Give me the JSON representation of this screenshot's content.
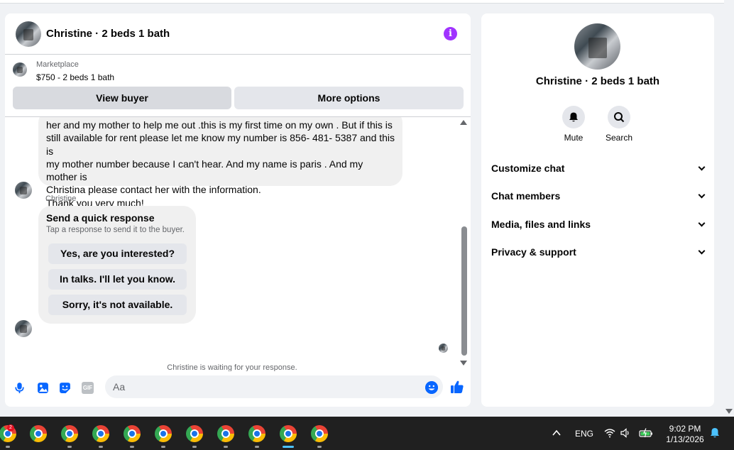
{
  "chat": {
    "title": "Christine · 2 beds 1 bath",
    "listing": {
      "label": "Marketplace",
      "price_title": "$750 - 2 beds 1 bath",
      "view_buyer": "View buyer",
      "more_options": "More options"
    },
    "message_lines": [
      "her and my mother to help me out .this is my first time on my own . But if this is",
      "still available for rent please let me know my number is 856- 481- 5387 and this is",
      "my mother number because I can't hear. And my name is paris . And my mother is",
      "Christina please contact her with the information.",
      "Thank you very much!"
    ],
    "sender": "Christine",
    "quick_response": {
      "title": "Send a quick response",
      "subtitle": "Tap a response to send it to the buyer.",
      "options": [
        "Yes, are you interested?",
        "In talks. I'll let you know.",
        "Sorry, it's not available."
      ]
    },
    "waiting_note": "Christine is waiting for your response.",
    "composer": {
      "placeholder": "Aa",
      "gif_label": "GIF"
    }
  },
  "info_panel": {
    "title": "Christine · 2 beds 1 bath",
    "actions": [
      {
        "label": "Mute",
        "icon": "bell-icon"
      },
      {
        "label": "Search",
        "icon": "search-icon"
      }
    ],
    "menu": [
      "Customize chat",
      "Chat members",
      "Media, files and links",
      "Privacy & support"
    ]
  },
  "taskbar": {
    "badge_count": "2",
    "language": "ENG",
    "time": "9:02 PM",
    "date": "1/13/2026"
  },
  "colors": {
    "accent": "#0866ff",
    "info_purple": "#a033ff",
    "bubble": "#f0f0f0",
    "taskbar": "#202020"
  }
}
